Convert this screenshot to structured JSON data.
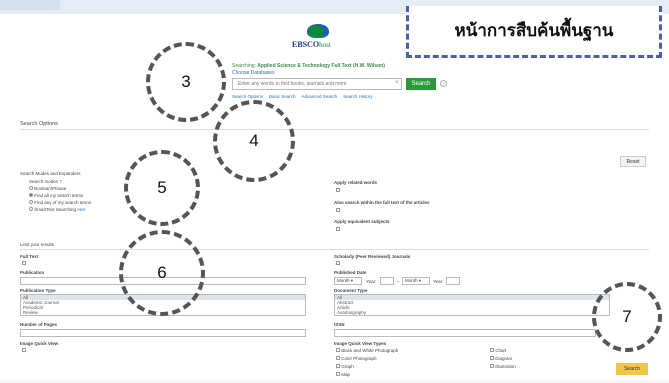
{
  "callout": {
    "title": "หน้าการสืบค้นพื้นฐาน"
  },
  "logo": {
    "brand": "EBSCO",
    "suffix": "host"
  },
  "search": {
    "searching_prefix": "Searching:",
    "database": "Applied Science & Technology Full Text (H.W. Wilson)",
    "choose_db": "Choose Databases",
    "placeholder": "Enter any words to find books, journals and more",
    "clear": "×",
    "button": "Search",
    "help": "?",
    "links": [
      "Search Options",
      "Basic Search",
      "Advanced Search",
      "Search History"
    ]
  },
  "callouts_numbers": [
    "3",
    "4",
    "5",
    "6",
    "7"
  ],
  "options": {
    "title": "Search Options",
    "reset": "Reset",
    "modes_title": "Search Modes and Expanders",
    "search_modes_label": "Search modes",
    "search_modes_help": "?",
    "modes": [
      "Boolean/Phrase",
      "Find all my search terms",
      "Find any of my search terms",
      "SmartText Searching"
    ],
    "smarttext_hint": "Hint",
    "apply_related": "Apply related words",
    "also_search": "Also search within the full text of the articles",
    "apply_equivalent": "Apply equivalent subjects"
  },
  "limits": {
    "title": "Limit your results",
    "full_text": "Full Text",
    "scholarly": "Scholarly (Peer Reviewed) Journals",
    "publication": "Publication",
    "published_date": "Published Date",
    "date_month": "Month",
    "date_year": "Year:",
    "date_dash": "–",
    "publication_type": "Publication Type",
    "pub_types": [
      "All",
      "Academic Journal",
      "Periodical",
      "Review"
    ],
    "document_type": "Document Type",
    "doc_types": [
      "All",
      "Abstract",
      "Article",
      "Autobiography"
    ],
    "number_of_pages": "Number of Pages",
    "issn": "ISSN",
    "image_quick_view": "Image Quick View",
    "image_quick_view_types": "Image Quick View Types",
    "iqv_types": [
      "Black and White Photograph",
      "Chart",
      "Color Photograph",
      "Diagram",
      "Graph",
      "Illustration",
      "Map"
    ],
    "search_button": "Search"
  }
}
